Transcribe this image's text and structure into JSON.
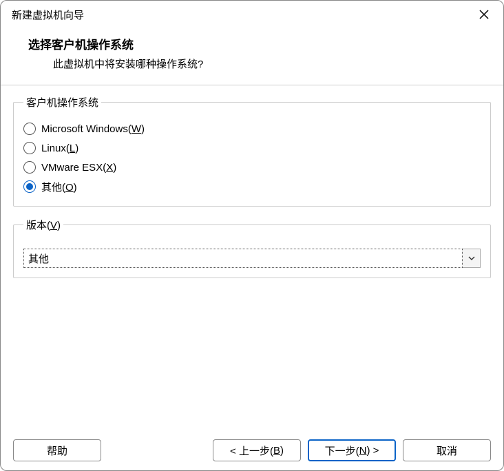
{
  "titlebar": {
    "title": "新建虚拟机向导"
  },
  "header": {
    "title": "选择客户机操作系统",
    "subtitle": "此虚拟机中将安装哪种操作系统?"
  },
  "os_group": {
    "legend": "客户机操作系统",
    "options": [
      {
        "label_pre": "Microsoft Windows(",
        "mnemonic": "W",
        "label_post": ")",
        "selected": false
      },
      {
        "label_pre": "Linux(",
        "mnemonic": "L",
        "label_post": ")",
        "selected": false
      },
      {
        "label_pre": "VMware ESX(",
        "mnemonic": "X",
        "label_post": ")",
        "selected": false
      },
      {
        "label_pre": "其他(",
        "mnemonic": "O",
        "label_post": ")",
        "selected": true
      }
    ]
  },
  "version_group": {
    "legend_pre": "版本(",
    "legend_mnemonic": "V",
    "legend_post": ")",
    "selected": "其他"
  },
  "footer": {
    "help": "帮助",
    "back_pre": "< 上一步(",
    "back_mnemonic": "B",
    "back_post": ")",
    "next_pre": "下一步(",
    "next_mnemonic": "N",
    "next_post": ") >",
    "cancel": "取消"
  }
}
